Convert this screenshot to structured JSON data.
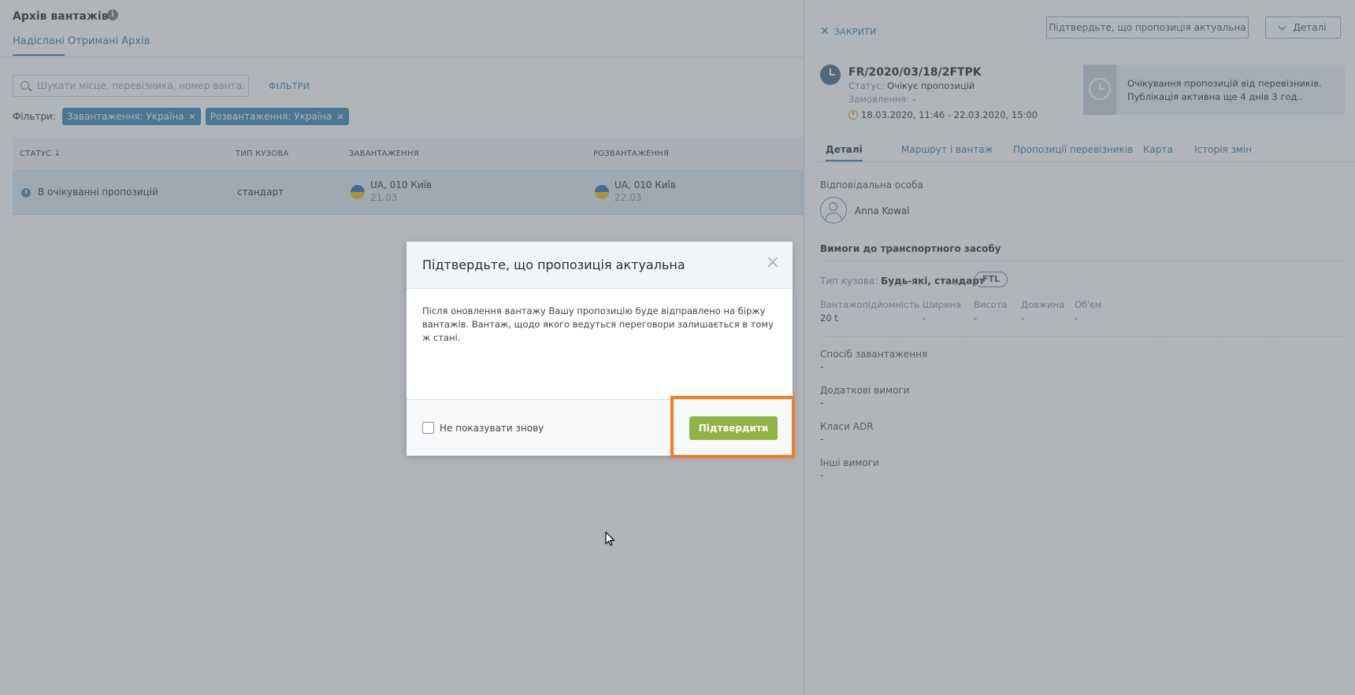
{
  "main": {
    "title": "Архів вантажів",
    "tabs": [
      {
        "label": "Надіслані",
        "active": true
      },
      {
        "label": "Отримані",
        "active": false
      },
      {
        "label": "Архів",
        "active": false
      }
    ],
    "search": {
      "placeholder": "Шукати місце, перевізника, номер вантажу ..."
    },
    "filters_link": "ФІЛЬТРИ",
    "filters_label": "Фільтри:",
    "filter_chips": [
      "Завантаження: Україна",
      "Розвантаження: Україна"
    ],
    "table": {
      "columns": [
        "СТАТУС ↓",
        "ТИП КУЗОВА",
        "ЗАВАНТАЖЕННЯ",
        "РОЗВАНТАЖЕННЯ"
      ],
      "rows": [
        {
          "status": "В очікуванні пропозицій",
          "body_type": "стандарт",
          "loading": {
            "place": "UA, 010 Київ",
            "date": "21.03"
          },
          "unloading": {
            "place": "UA, 010 Київ",
            "date": "22.03"
          }
        }
      ]
    }
  },
  "panel": {
    "close_label": "ЗАКРИТИ",
    "confirm_actual_button": "Підтвердьте, що пропозиція актуальна",
    "details_button": "Деталі",
    "cargo_id": "FR/2020/03/18/2FTPK",
    "status_label": "Статус:",
    "status_value": "Очікує пропозицій",
    "order_label": "Замовлення:",
    "order_value": "-",
    "period": "18.03.2020, 11:46 - 22.03.2020, 15:00",
    "notice_line1": "Очікування пропозицій від перевізників.",
    "notice_line2": "Публікація активна ще 4 днів 3 год..",
    "tabs": [
      "Деталі",
      "Маршрут і вантаж",
      "Пропозиції перевізників",
      "Карта",
      "Історія змін"
    ],
    "responsible_label": "Відповідальна особа",
    "responsible_name": "Anna Kowal",
    "vehicle_section": "Вимоги до транспортного засобу",
    "body_type_label": "Тип кузова:",
    "body_type_value": "Будь-які, стандарт",
    "ftl_badge": "FTL",
    "specs": [
      {
        "label": "Вантажопідйомність",
        "value": "20 t"
      },
      {
        "label": "Ширина",
        "value": "-"
      },
      {
        "label": "Висота",
        "value": "-"
      },
      {
        "label": "Довжина",
        "value": "-"
      },
      {
        "label": "Об'єм",
        "value": "-"
      }
    ],
    "extra": [
      {
        "label": "Спосіб завантаження",
        "value": "-"
      },
      {
        "label": "Додаткові вимоги",
        "value": "-"
      },
      {
        "label": "Класи ADR",
        "value": "-"
      },
      {
        "label": "Інші вимоги",
        "value": "-"
      }
    ]
  },
  "dialog": {
    "title": "Підтвердьте, що пропозиція актуальна",
    "close_symbol": "×",
    "body_line1": "Після оновлення вантажу Вашу пропозицію буде відправлено на біржу",
    "body_line2": "вантажів. Вантаж, щодо якого ведуться переговори залишається в тому ж стані.",
    "checkbox_label": "Не показувати знову",
    "checkbox_checked": false,
    "confirm_button": "Підтвердити"
  },
  "colors": {
    "accent": "#3a7fa8",
    "chip": "#3a86ae",
    "confirm": "#8fb443",
    "highlight": "#f07e26",
    "overlay": "#5a646e"
  }
}
